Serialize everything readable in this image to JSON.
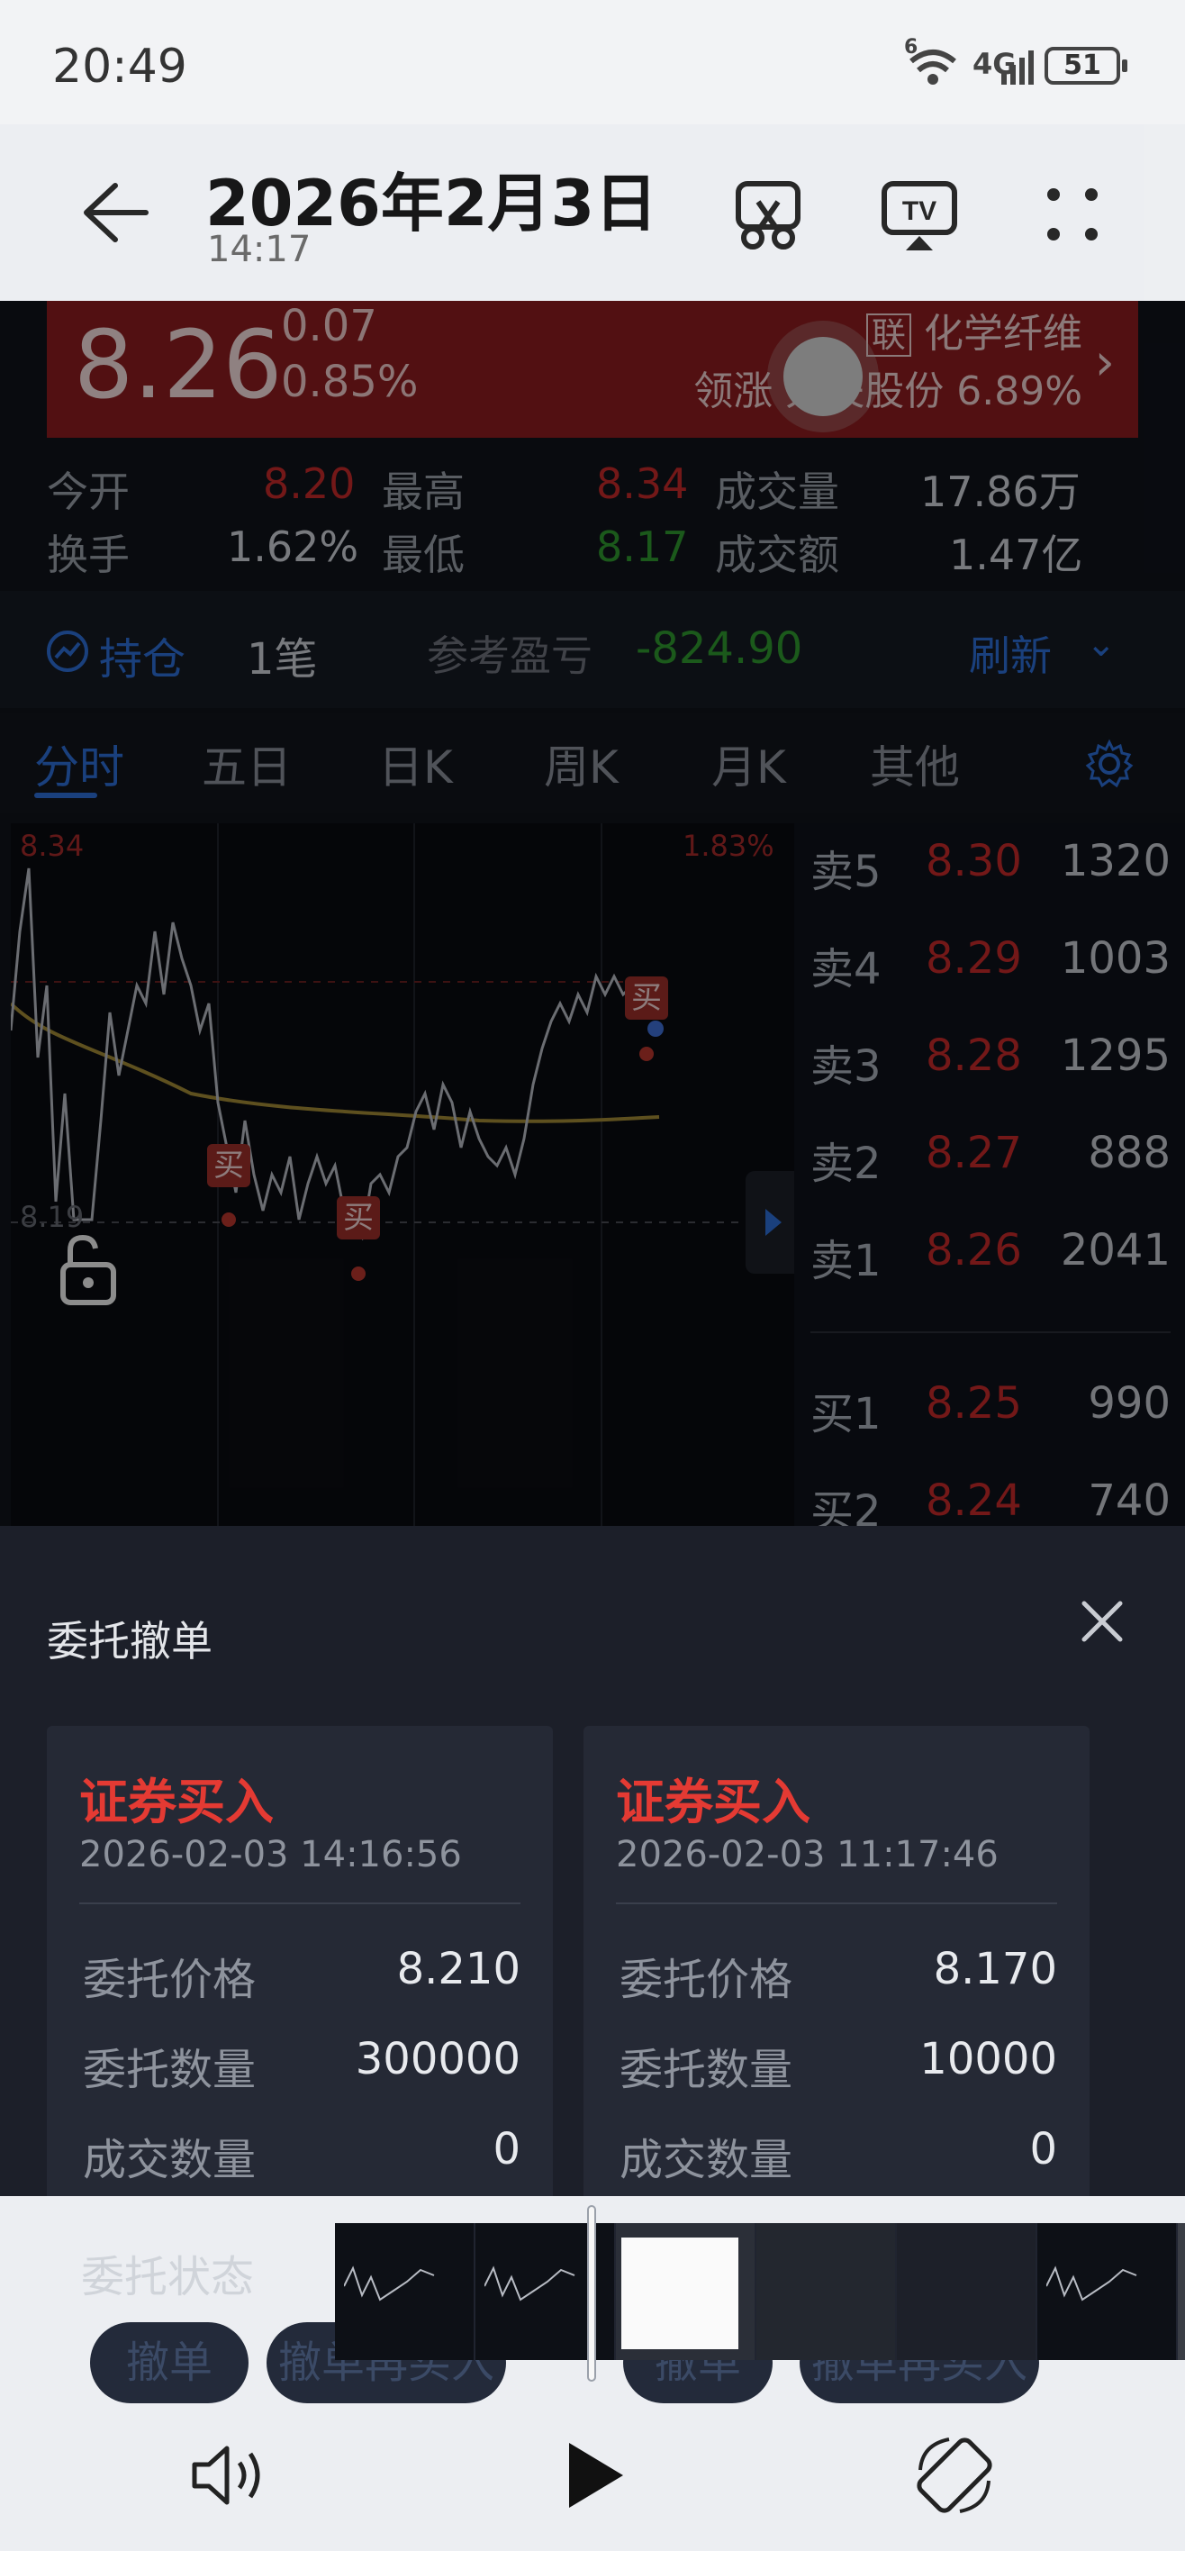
{
  "status_bar": {
    "time": "20:49",
    "wifi_badge": "6",
    "network": "4G",
    "battery": "51"
  },
  "viewer": {
    "title": "2026年2月3日",
    "subtitle": "14:17"
  },
  "quote": {
    "price": "8.26",
    "change": "0.07",
    "change_pct": "0.85%",
    "sector_prefix": "联",
    "sector": "化学纤维",
    "leader_label": "领涨",
    "leader_name": "尤夫股份",
    "leader_pct": "6.89%",
    "stats": {
      "open_label": "今开",
      "open": "8.20",
      "high_label": "最高",
      "high": "8.34",
      "volume_label": "成交量",
      "volume": "17.86万",
      "turnover_label": "换手",
      "turnover": "1.62%",
      "low_label": "最低",
      "low": "8.17",
      "amount_label": "成交额",
      "amount": "1.47亿"
    }
  },
  "holdings": {
    "label": "持仓",
    "count": "1笔",
    "pl_label": "参考盈亏",
    "pl_value": "-824.90",
    "refresh": "刷新"
  },
  "tabs": [
    "分时",
    "五日",
    "日K",
    "周K",
    "月K",
    "其他"
  ],
  "chart": {
    "top_left": "8.34",
    "top_right": "1.83%",
    "mid_left": "8.19",
    "marker_label": "买"
  },
  "orderbook": {
    "asks": [
      {
        "label": "卖5",
        "price": "8.30",
        "vol": "1320"
      },
      {
        "label": "卖4",
        "price": "8.29",
        "vol": "1003"
      },
      {
        "label": "卖3",
        "price": "8.28",
        "vol": "1295"
      },
      {
        "label": "卖2",
        "price": "8.27",
        "vol": "888"
      },
      {
        "label": "卖1",
        "price": "8.26",
        "vol": "2041"
      }
    ],
    "bids": [
      {
        "label": "买1",
        "price": "8.25",
        "vol": "990"
      },
      {
        "label": "买2",
        "price": "8.24",
        "vol": "740"
      }
    ]
  },
  "sheet": {
    "title": "委托撤单",
    "orders": [
      {
        "type": "证券买入",
        "time": "2026-02-03 14:16:56",
        "price_label": "委托价格",
        "price": "8.210",
        "qty_label": "委托数量",
        "qty": "300000",
        "filled_label": "成交数量",
        "filled": "0"
      },
      {
        "type": "证券买入",
        "time": "2026-02-03 11:17:46",
        "price_label": "委托价格",
        "price": "8.170",
        "qty_label": "委托数量",
        "qty": "10000",
        "filled_label": "成交数量",
        "filled": "0"
      }
    ],
    "status_label": "委托状态",
    "cancel": "撤单",
    "cancel_rebuy": "撤单再买入"
  }
}
